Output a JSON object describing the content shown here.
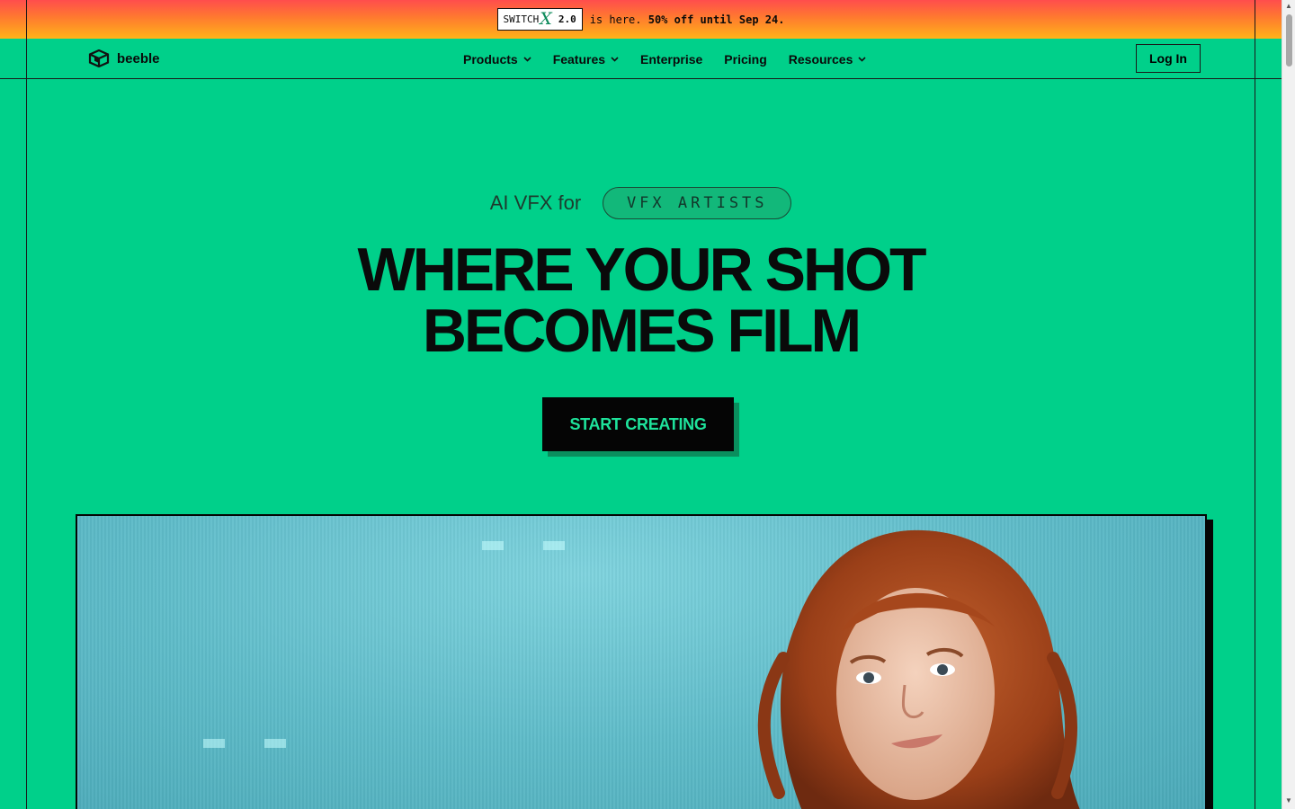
{
  "banner": {
    "badge_prefix": "SWITCH",
    "badge_x": "X",
    "badge_version": "2.0",
    "text": "is here.",
    "offer": "50% off until Sep 24."
  },
  "nav": {
    "brand": "beeble",
    "items": [
      {
        "label": "Products",
        "dropdown": true
      },
      {
        "label": "Features",
        "dropdown": true
      },
      {
        "label": "Enterprise",
        "dropdown": false
      },
      {
        "label": "Pricing",
        "dropdown": false
      },
      {
        "label": "Resources",
        "dropdown": true
      }
    ],
    "login": "Log In"
  },
  "hero": {
    "prefix": "AI VFX for",
    "rotating_word": "VFX ARTISTS",
    "headline_line1": "WHERE YOUR SHOT",
    "headline_line2": "BECOMES FILM",
    "cta": "START CREATING"
  },
  "colors": {
    "background": "#00d08a",
    "banner_top": "#ff4d4d",
    "banner_bottom": "#ffb319",
    "cta_bg": "#050505",
    "cta_text": "#1ee39b"
  },
  "icons": {
    "logo": "beeble-cube-logo",
    "dropdown": "chevron-down-icon"
  }
}
